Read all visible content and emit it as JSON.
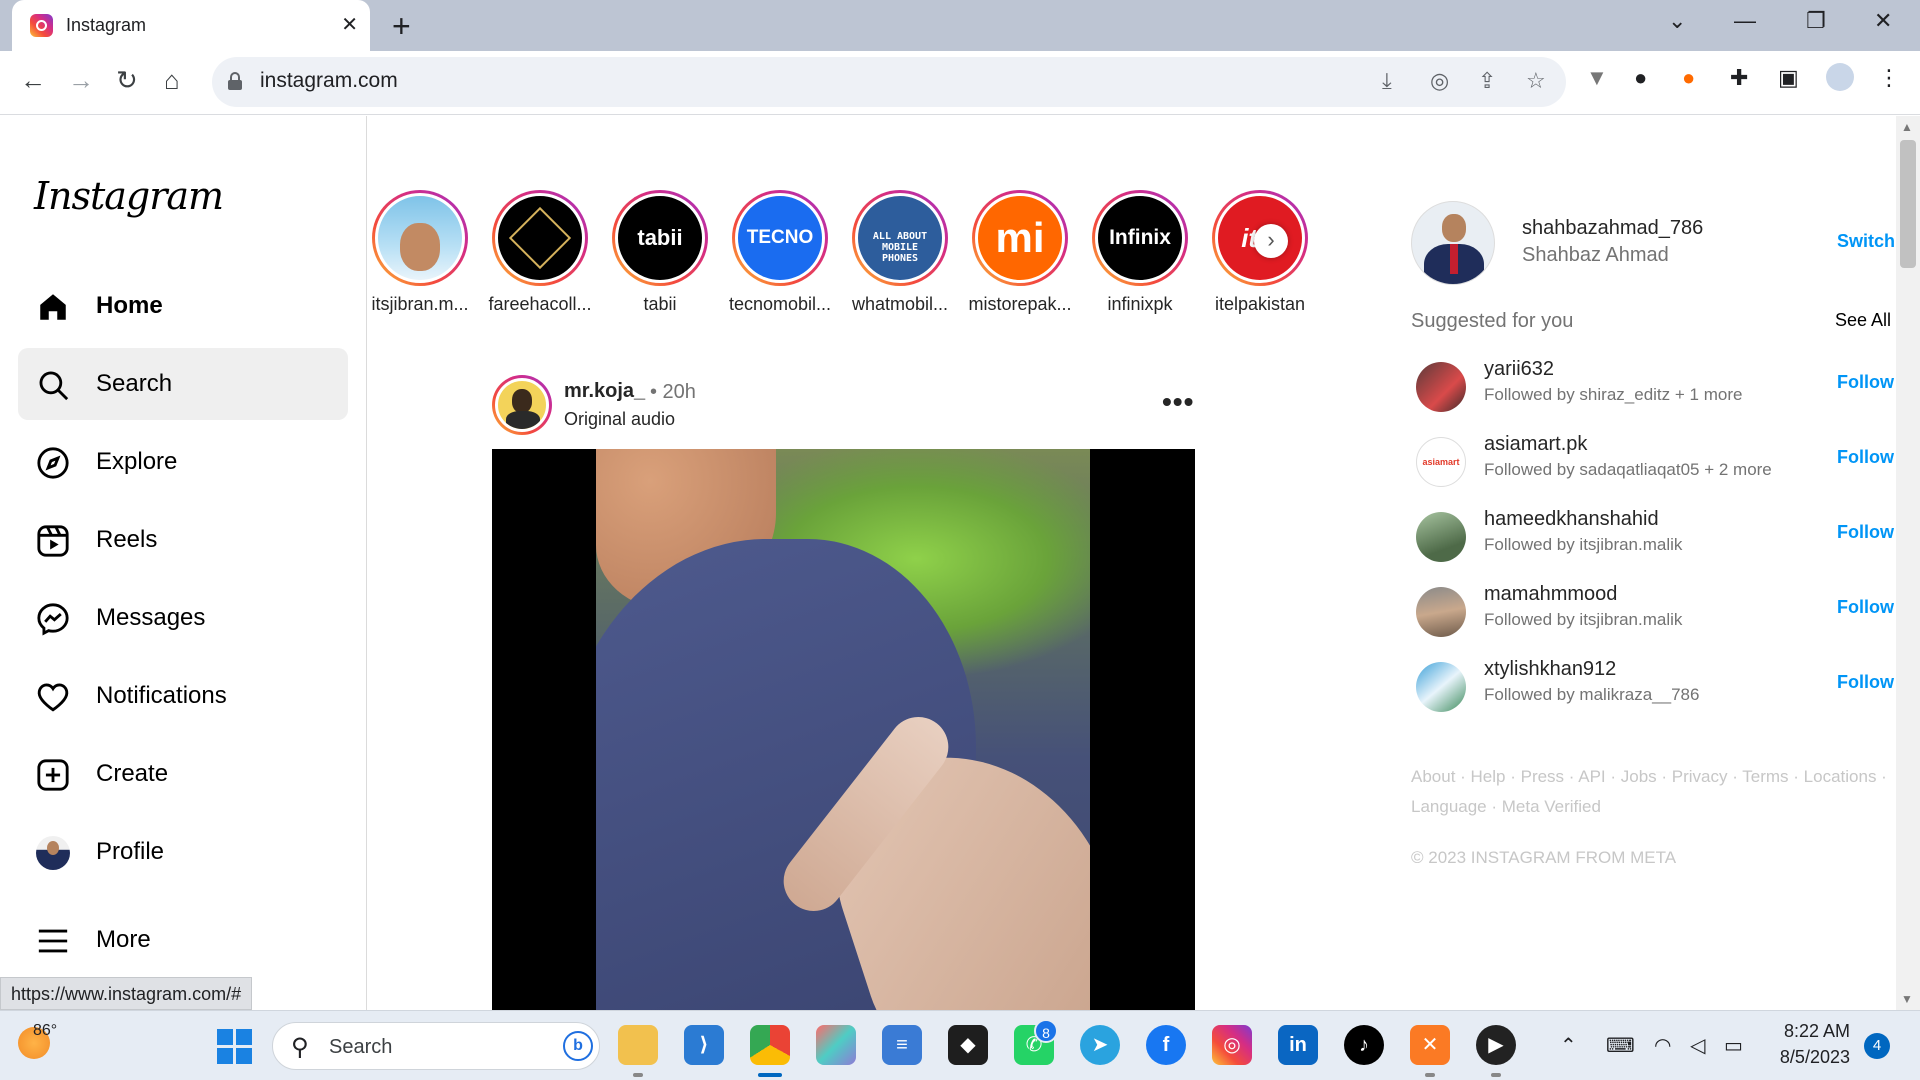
{
  "browser": {
    "tab_title": "Instagram",
    "tab_close": "✕",
    "new_tab": "+",
    "url": "instagram.com",
    "status_url": "https://www.instagram.com/#",
    "window_controls": [
      "⌄",
      "—",
      "❐",
      "✕"
    ]
  },
  "instagram": {
    "logo_text": "Instagram",
    "nav": [
      {
        "label": "Home",
        "icon": "home-icon"
      },
      {
        "label": "Search",
        "icon": "search-icon"
      },
      {
        "label": "Explore",
        "icon": "compass-icon"
      },
      {
        "label": "Reels",
        "icon": "reels-icon"
      },
      {
        "label": "Messages",
        "icon": "messenger-icon"
      },
      {
        "label": "Notifications",
        "icon": "heart-icon"
      },
      {
        "label": "Create",
        "icon": "plus-square-icon"
      },
      {
        "label": "Profile",
        "icon": "avatar"
      },
      {
        "label": "More",
        "icon": "menu-icon"
      }
    ],
    "stories": [
      {
        "name": "itsjibran.m...",
        "logo": ""
      },
      {
        "name": "fareehacoll...",
        "logo": ""
      },
      {
        "name": "tabii",
        "logo": "tabii"
      },
      {
        "name": "tecnomobil...",
        "logo": "TECNO"
      },
      {
        "name": "whatmobil...",
        "logo": "ALL ABOUT MOBILE PHONES"
      },
      {
        "name": "mistorepak...",
        "logo": "mi"
      },
      {
        "name": "infinixpk",
        "logo": "Infinix"
      },
      {
        "name": "itelpakistan",
        "logo": "itel"
      }
    ],
    "story_next": "›",
    "post": {
      "username": "mr.koja_",
      "time": "• 20h",
      "audio": "Original audio",
      "more": "•••"
    },
    "current_user": {
      "username": "shahbazahmad_786",
      "full_name": "Shahbaz Ahmad",
      "switch_label": "Switch"
    },
    "suggestions_title": "Suggested for you",
    "see_all": "See All",
    "suggestions": [
      {
        "username": "yarii632",
        "sub": "Followed by shiraz_editz + 1 more",
        "action": "Follow"
      },
      {
        "username": "asiamart.pk",
        "sub": "Followed by sadaqatliaqat05 + 2 more",
        "action": "Follow"
      },
      {
        "username": "hameedkhanshahid",
        "sub": "Followed by itsjibran.malik",
        "action": "Follow"
      },
      {
        "username": "mamahmmood",
        "sub": "Followed by itsjibran.malik",
        "action": "Follow"
      },
      {
        "username": "xtylishkhan912",
        "sub": "Followed by malikraza__786",
        "action": "Follow"
      }
    ],
    "footer_links": "About · Help · Press · API · Jobs · Privacy · Terms · Locations · Language · Meta Verified",
    "footer_copy": "© 2023 INSTAGRAM FROM META"
  },
  "taskbar": {
    "weather_temp": "86°",
    "search_label": "Search",
    "whatsapp_badge": "8",
    "time": "8:22 AM",
    "date": "8/5/2023",
    "notification_count": "4"
  },
  "colors": {
    "accent_blue": "#0095f6",
    "story_gradient": [
      "#fdc33a",
      "#f44c3b",
      "#d52d84",
      "#a233c4"
    ],
    "tab_strip": "#bdc5d3"
  }
}
